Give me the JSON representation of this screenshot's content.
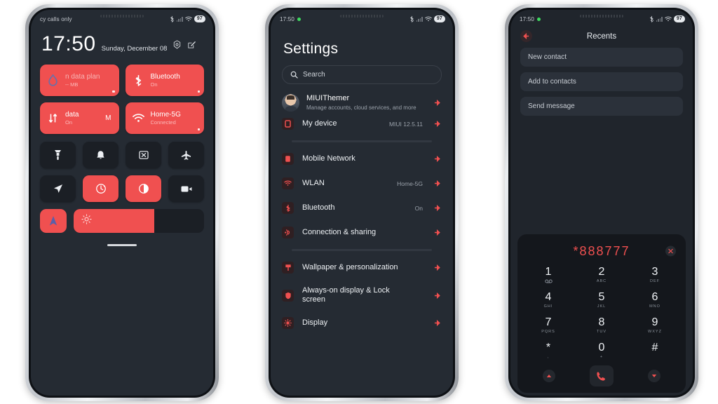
{
  "phone1": {
    "status": {
      "carrier": "cy calls only",
      "battery": "97"
    },
    "clock": {
      "time": "17:50",
      "date": "Sunday, December 08"
    },
    "header_icons": {
      "settings": "gear-icon",
      "edit": "edit-icon"
    },
    "tiles": [
      {
        "label": "n data plan",
        "sub": "-- MB",
        "icon": "data-drop-icon",
        "state": "on",
        "right": ""
      },
      {
        "label": "Bluetooth",
        "sub": "On",
        "icon": "bluetooth-icon",
        "state": "on",
        "right": ""
      },
      {
        "label": "data",
        "sub": "On",
        "icon": "mobile-data-icon",
        "state": "on",
        "right": "M"
      },
      {
        "label": "Home-5G",
        "sub": "Connected",
        "icon": "wifi-icon",
        "state": "on",
        "right": ""
      }
    ],
    "quick": [
      {
        "icon": "flashlight-icon",
        "on": false
      },
      {
        "icon": "bell-icon",
        "on": false
      },
      {
        "icon": "screenshot-icon",
        "on": false
      },
      {
        "icon": "airplane-icon",
        "on": false
      },
      {
        "icon": "location-icon",
        "on": false
      },
      {
        "icon": "auto-rotate-icon",
        "on": true
      },
      {
        "icon": "dark-mode-icon",
        "on": true
      },
      {
        "icon": "screen-record-icon",
        "on": false
      }
    ],
    "bottom": {
      "nav_icon": "navigation-arrow-icon",
      "brightness_icon": "brightness-icon",
      "brightness_percent": 62
    }
  },
  "phone2": {
    "status": {
      "time": "17:50",
      "battery": "97"
    },
    "title": "Settings",
    "search": {
      "placeholder": "Search",
      "icon": "search-icon"
    },
    "account": {
      "name": "MIUIThemer",
      "subtitle": "Manage accounts, cloud services, and more",
      "avatar": "user-avatar"
    },
    "items": [
      {
        "label": "My device",
        "value": "MIUI 12.5.11",
        "icon": "device-icon"
      },
      {
        "label": "Mobile Network",
        "value": "",
        "icon": "sim-icon"
      },
      {
        "label": "WLAN",
        "value": "Home-5G",
        "icon": "wifi-icon"
      },
      {
        "label": "Bluetooth",
        "value": "On",
        "icon": "bluetooth-icon"
      },
      {
        "label": "Connection & sharing",
        "value": "",
        "icon": "connection-sharing-icon"
      },
      {
        "label": "Wallpaper & personalization",
        "value": "",
        "icon": "wallpaper-icon"
      },
      {
        "label": "Always-on display & Lock screen",
        "value": "",
        "icon": "lock-screen-icon"
      },
      {
        "label": "Display",
        "value": "",
        "icon": "display-icon"
      }
    ]
  },
  "phone3": {
    "status": {
      "time": "17:50",
      "battery": "97"
    },
    "header": {
      "title": "Recents",
      "back_icon": "back-arrow-icon"
    },
    "actions": [
      "New contact",
      "Add to contacts",
      "Send message"
    ],
    "dialer": {
      "number": "*888777",
      "delete_icon": "clear-icon",
      "keys": [
        {
          "digit": "1",
          "letters": ""
        },
        {
          "digit": "2",
          "letters": "ABC"
        },
        {
          "digit": "3",
          "letters": "DEF"
        },
        {
          "digit": "4",
          "letters": "GHI"
        },
        {
          "digit": "5",
          "letters": "JKL"
        },
        {
          "digit": "6",
          "letters": "MNO"
        },
        {
          "digit": "7",
          "letters": "PQRS"
        },
        {
          "digit": "8",
          "letters": "TUV"
        },
        {
          "digit": "9",
          "letters": "WXYZ"
        },
        {
          "digit": "*",
          "letters": ","
        },
        {
          "digit": "0",
          "letters": "+"
        },
        {
          "digit": "#",
          "letters": ""
        }
      ],
      "call_icon": "call-icon",
      "left_icon": "expand-up-icon",
      "right_icon": "expand-down-icon"
    }
  },
  "colors": {
    "accent": "#f05050",
    "screen_bg": "#252b33",
    "tile_bg": "#1b1f25"
  }
}
